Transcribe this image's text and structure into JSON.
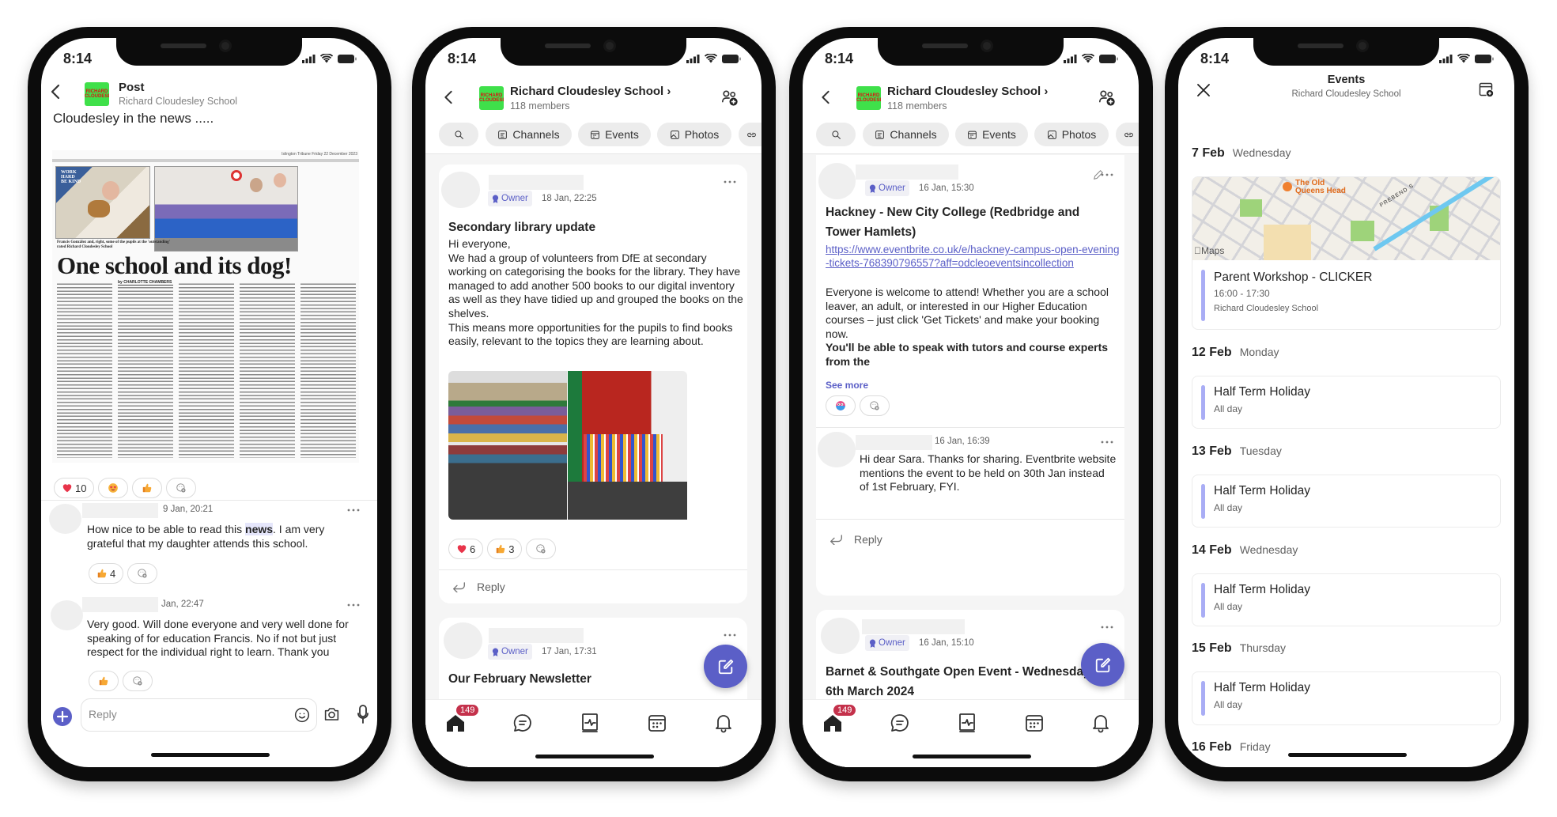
{
  "status_time": "8:14",
  "colors": {
    "accent": "#5b5fc7",
    "badge": "#c4314b",
    "event_bar": "#a9adf5",
    "logo_green": "#3fe04a"
  },
  "logo_text": "RICHARD CLOUDESLEY",
  "phone1": {
    "header": {
      "title": "Post",
      "subtitle": "Richard Cloudesley School"
    },
    "post_title": "Cloudesley in the news .....",
    "newspaper": {
      "masthead": "Islington Tribune  Friday 22 December 2023",
      "caption": "Francis González and, right, some of the pupils at the 'outstanding' rated Richard Cloudesley School",
      "headline": "One school and its dog!",
      "byline": "by CHARLOTTE CHAMBERS",
      "sign_text": "WORK HARD BE KIND"
    },
    "reactions": [
      {
        "icon": "heart-icon",
        "count": "10"
      },
      {
        "icon": "heart-eyes-icon",
        "count": ""
      },
      {
        "icon": "thumbs-up-icon",
        "count": ""
      }
    ],
    "comments": [
      {
        "time": "9 Jan, 20:21",
        "text_before": "How nice to be able to read this ",
        "highlight": "news",
        "text_after": ". I am very grateful that my daughter attends this school.",
        "reaction_count": "4"
      },
      {
        "time": "Jan, 22:47",
        "text": "Very good. Will done everyone and very well done for speaking of for education Francis. No if not but just respect for the individual right to learn. Thank you"
      }
    ],
    "reply_placeholder": "Reply"
  },
  "group_header": {
    "title": "Richard Cloudesley School",
    "members": "118 members"
  },
  "pills": [
    "Channels",
    "Events",
    "Photos"
  ],
  "owner_label": "Owner",
  "reply_label": "Reply",
  "home_badge": "149",
  "phone2": {
    "post1": {
      "time": "18 Jan, 22:25",
      "title": "Secondary library update",
      "body": [
        "Hi everyone,",
        "We had a group of volunteers from DfE at secondary working on categorising the books for the library. They have managed to add another 500 books to our digital inventory as well as they have tidied up and grouped the books on the shelves.",
        "This means more opportunities for the pupils to find books easily, relevant to the topics they are learning about."
      ],
      "reactions": [
        {
          "icon": "heart-icon",
          "count": "6"
        },
        {
          "icon": "thumbs-up-icon",
          "count": "3"
        }
      ]
    },
    "post2": {
      "time": "17 Jan, 17:31",
      "title": "Our February Newsletter"
    }
  },
  "phone3": {
    "post1": {
      "time": "16 Jan, 15:30",
      "title": "Hackney - New City College (Redbridge and Tower Hamlets)",
      "link": "https://www.eventbrite.co.uk/e/hackney-campus-open-evening-tickets-768390796557?aff=odcleoeventsincollection",
      "body": "Everyone is welcome to attend! Whether you are a school leaver, an adult, or interested in our Higher Education courses – just click 'Get Tickets' and make your booking now.",
      "bold": "You'll be able to speak with tutors and course experts from the",
      "see_more": "See more",
      "comment": {
        "time": "16 Jan, 16:39",
        "text": "Hi dear Sara. Thanks for sharing. Eventbrite website mentions the event to be held on 30th Jan instead of 1st February, FYI."
      }
    },
    "post2": {
      "time": "16 Jan, 15:10",
      "title_line1": "Barnet & Southgate Open Event - Wednesday",
      "title_line2": "6th March 2024"
    }
  },
  "phone4": {
    "header": {
      "title": "Events",
      "subtitle": "Richard Cloudesley School"
    },
    "map": {
      "poi": "The Old Queens Head",
      "street": "PREBEND S",
      "attribution": "Maps"
    },
    "days": [
      {
        "date": "7 Feb",
        "weekday": "Wednesday",
        "event": {
          "title": "Parent Workshop - CLICKER",
          "time": "16:00 - 17:30",
          "location": "Richard Cloudesley School"
        }
      },
      {
        "date": "12 Feb",
        "weekday": "Monday",
        "event": {
          "title": "Half Term Holiday",
          "time": "All day"
        }
      },
      {
        "date": "13 Feb",
        "weekday": "Tuesday",
        "event": {
          "title": "Half Term Holiday",
          "time": "All day"
        }
      },
      {
        "date": "14 Feb",
        "weekday": "Wednesday",
        "event": {
          "title": "Half Term Holiday",
          "time": "All day"
        }
      },
      {
        "date": "15 Feb",
        "weekday": "Thursday",
        "event": {
          "title": "Half Term Holiday",
          "time": "All day"
        }
      },
      {
        "date": "16 Feb",
        "weekday": "Friday"
      }
    ]
  }
}
